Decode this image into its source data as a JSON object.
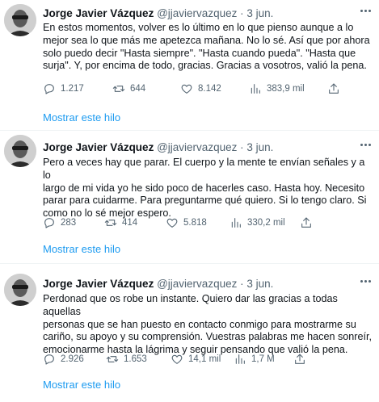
{
  "tweets": [
    {
      "name": "Jorge Javier Vázquez",
      "handle": "@jjaviervazquez",
      "separator": "·",
      "date": "3 jun.",
      "text": "En estos momentos, volver es lo último en lo que pienso aunque a lo\nmejor sea lo que más me apetezca mañana. No lo sé. Así que por ahora\nsolo puedo decir \"Hasta siempre\". \"Hasta cuando pueda\". \"Hasta que\nsurja\". Y, por encima de todo, gracias. Gracias a vosotros, valió la pena.",
      "replies": "1.217",
      "retweets": "644",
      "likes": "8.142",
      "views": "383,9 mil",
      "show_thread": "Mostrar este hilo"
    },
    {
      "name": "Jorge Javier Vázquez",
      "handle": "@jjaviervazquez",
      "separator": "·",
      "date": "3 jun.",
      "text": "Pero a veces hay que parar. El cuerpo y la mente te envían señales y a lo\nlargo de mi vida yo he sido poco de hacerles caso. Hasta hoy. Necesito\nparar para cuidarme. Para preguntarme qué quiero. Si lo tengo claro. Si\ncomo no lo sé mejor espero.",
      "replies": "283",
      "retweets": "414",
      "likes": "5.818",
      "views": "330,2 mil",
      "show_thread": "Mostrar este hilo"
    },
    {
      "name": "Jorge Javier Vázquez",
      "handle": "@jjaviervazquez",
      "separator": "·",
      "date": "3 jun.",
      "text": "Perdonad que os robe un instante. Quiero dar las gracias a todas aquellas\npersonas que se han puesto en contacto conmigo para mostrarme su\ncariño, su apoyo y su comprensión.  Vuestras palabras me hacen sonreír,\nemocionarme hasta la lágrima y seguir pensando que valió la pena.",
      "replies": "2.926",
      "retweets": "1.653",
      "likes": "14,1 mil",
      "views": "1,7 M",
      "show_thread": "Mostrar este hilo"
    }
  ],
  "icons": {
    "reply": "reply-icon",
    "retweet": "retweet-icon",
    "like": "heart-icon",
    "views": "views-icon",
    "share": "share-icon",
    "more": "more-icon"
  },
  "colors": {
    "link": "#1d9bf0",
    "secondary_text": "#536471",
    "divider": "#eff3f4"
  }
}
